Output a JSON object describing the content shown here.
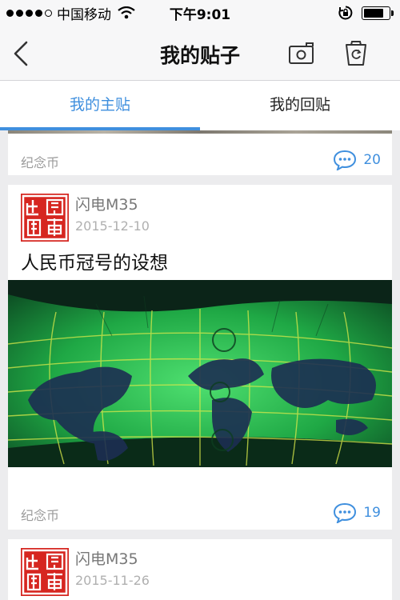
{
  "status_bar": {
    "carrier": "中国移动",
    "time": "下午9:01"
  },
  "nav": {
    "title": "我的贴子"
  },
  "tabs": [
    {
      "label": "我的主贴",
      "active": true
    },
    {
      "label": "我的回贴",
      "active": false
    }
  ],
  "posts": [
    {
      "tag": "纪念币",
      "comments": "20"
    },
    {
      "author": "闪电M35",
      "date": "2015-12-10",
      "title": "人民币冠号的设想",
      "tag": "纪念币",
      "comments": "19"
    },
    {
      "author": "闪电M35",
      "date": "2015-11-26"
    }
  ],
  "colors": {
    "accent": "#3f8fde",
    "avatar": "#d62620"
  },
  "icons": {
    "back": "chevron-left-icon",
    "camera": "camera-icon",
    "trash": "trash-refresh-icon",
    "comment": "speech-bubble-icon"
  }
}
